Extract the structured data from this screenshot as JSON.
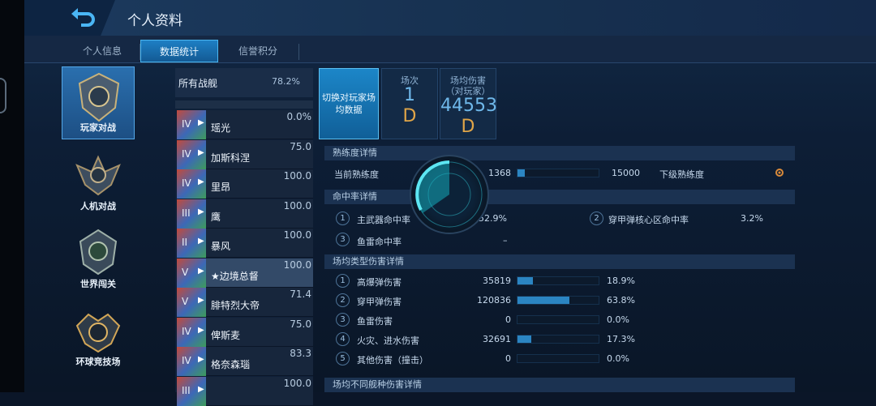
{
  "header": {
    "title": "个人资料"
  },
  "tabs": [
    "个人信息",
    "数据统计",
    "信誉积分"
  ],
  "modes": [
    {
      "label": "玩家对战",
      "icon": "medal-icon"
    },
    {
      "label": "人机对战",
      "icon": "winged-emblem-icon"
    },
    {
      "label": "世界闯关",
      "icon": "globe-emblem-icon"
    },
    {
      "label": "环球竞技场",
      "icon": "arena-emblem-icon"
    }
  ],
  "shiplist": {
    "all_label": "所有战舰",
    "all_pct": "78.2%",
    "ships": [
      {
        "tier": "IV",
        "name": "瑶光",
        "pct": "0.0%"
      },
      {
        "tier": "IV",
        "name": "加斯科涅",
        "pct": "75.0"
      },
      {
        "tier": "IV",
        "name": "里昂",
        "pct": "100.0"
      },
      {
        "tier": "III",
        "name": "鹰",
        "pct": "100.0"
      },
      {
        "tier": "II",
        "name": "暴风",
        "pct": "100.0"
      },
      {
        "tier": "V",
        "name": "★边境总督",
        "pct": "100.0"
      },
      {
        "tier": "V",
        "name": "腓特烈大帝",
        "pct": "71.4"
      },
      {
        "tier": "IV",
        "name": "俾斯麦",
        "pct": "75.0"
      },
      {
        "tier": "IV",
        "name": "格奈森瑙",
        "pct": "83.3"
      },
      {
        "tier": "III",
        "name": "",
        "pct": "100.0"
      }
    ]
  },
  "stats": {
    "switch_label": "切换对玩家场均数据",
    "battles": {
      "label": "场次",
      "value": "1",
      "grade": "D"
    },
    "damage": {
      "label": "场均伤害\n（对玩家）",
      "value": "44553",
      "grade": "D"
    }
  },
  "proficiency": {
    "section": "熟练度详情",
    "current_label": "当前熟练度",
    "current": "1368",
    "next": "15000",
    "next_label": "下级熟练度",
    "progress": 0.09
  },
  "hit": {
    "section": "命中率详情",
    "items": [
      {
        "n": "1",
        "label": "主武器命中率",
        "value": "52.9%"
      },
      {
        "n": "2",
        "label": "穿甲弹核心区命中率",
        "value": "3.2%"
      },
      {
        "n": "3",
        "label": "鱼雷命中率",
        "value": "–"
      }
    ]
  },
  "damage_types": {
    "section": "场均类型伤害详情",
    "items": [
      {
        "n": "1",
        "label": "高爆弹伤害",
        "value": "35819",
        "pct": "18.9%",
        "frac": 0.189
      },
      {
        "n": "2",
        "label": "穿甲弹伤害",
        "value": "120836",
        "pct": "63.8%",
        "frac": 0.638
      },
      {
        "n": "3",
        "label": "鱼雷伤害",
        "value": "0",
        "pct": "0.0%",
        "frac": 0
      },
      {
        "n": "4",
        "label": "火灾、进水伤害",
        "value": "32691",
        "pct": "17.3%",
        "frac": 0.173
      },
      {
        "n": "5",
        "label": "其他伤害（撞击）",
        "value": "0",
        "pct": "0.0%",
        "frac": 0
      }
    ]
  },
  "ship_type_section": "场均不同舰种伤害详情"
}
